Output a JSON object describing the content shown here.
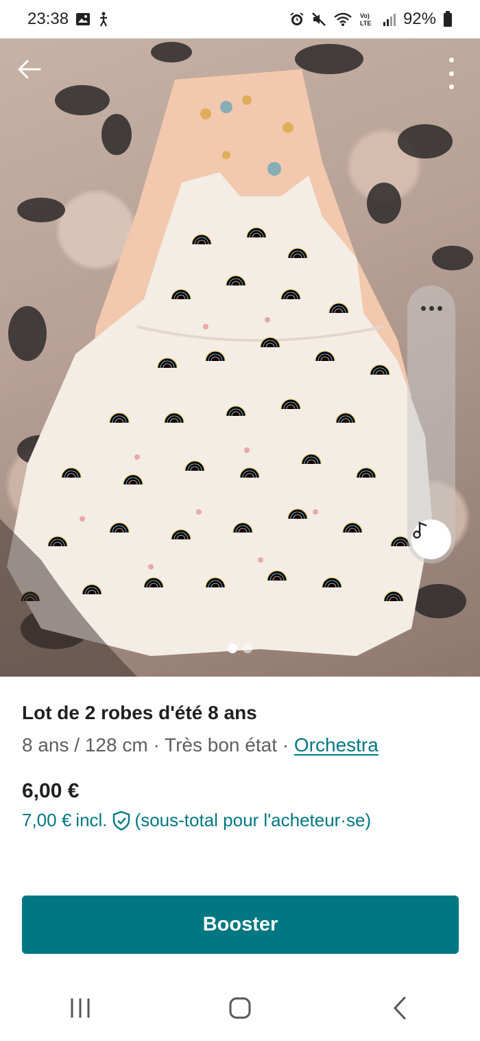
{
  "status_bar": {
    "time": "23:38",
    "battery": "92%",
    "left_icons": [
      "gallery-icon",
      "accessibility-icon"
    ],
    "right_icons": [
      "alarm-icon",
      "mute-icon",
      "wifi-icon",
      "volte-icon",
      "signal-icon",
      "battery-icon"
    ]
  },
  "listing": {
    "title": "Lot de 2 robes d'été 8 ans",
    "size": "8 ans / 128 cm",
    "separator": "·",
    "condition": "Très bon état",
    "brand": "Orchestra",
    "price": "6,00 €",
    "price_incl": "7,00 €",
    "incl_label": "incl.",
    "subtotal_label": "(sous-total pour l'acheteur·se)"
  },
  "gallery": {
    "total_photos": 2,
    "active_photo": 1
  },
  "actions": {
    "booster_label": "Booster"
  },
  "colors": {
    "accent": "#007782",
    "text": "#1f1f1f",
    "muted": "#5e5e5e"
  }
}
